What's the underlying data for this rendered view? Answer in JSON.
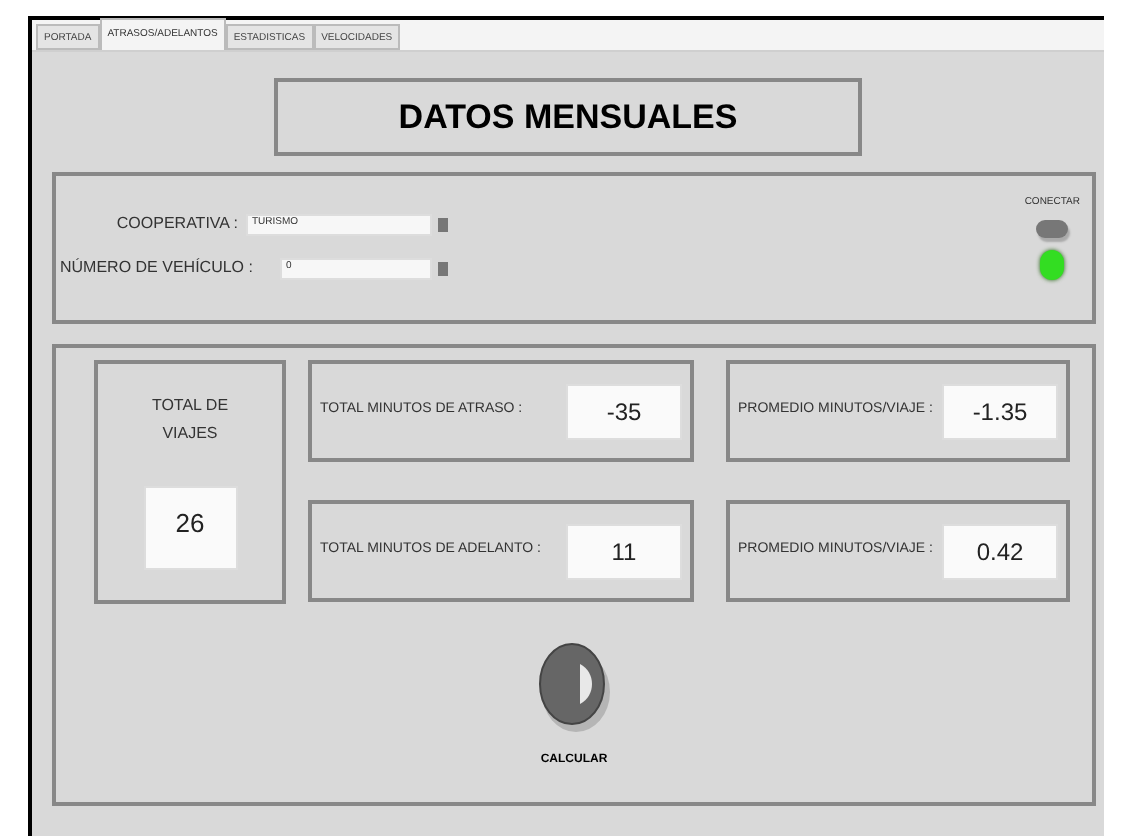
{
  "tabs": [
    {
      "label": "PORTADA",
      "selected": false
    },
    {
      "label": "ATRASOS/ADELANTOS",
      "selected": true
    },
    {
      "label": "ESTADISTICAS",
      "selected": false
    },
    {
      "label": "VELOCIDADES",
      "selected": false
    }
  ],
  "title": "DATOS MENSUALES",
  "connection": {
    "cooperativa_label": "COOPERATIVA :",
    "cooperativa_value": "TURISMO",
    "vehiculo_label": "NÚMERO DE VEHÍCULO :",
    "vehiculo_value": "0",
    "connect_label": "CONECTAR",
    "led_on": true
  },
  "total_viajes": {
    "label": "TOTAL DE VIAJES",
    "value": "26"
  },
  "indicators": [
    {
      "label": "TOTAL MINUTOS DE ATRASO :",
      "value": "-35"
    },
    {
      "label": "PROMEDIO MINUTOS/VIAJE :",
      "value": "-1.35"
    },
    {
      "label": "TOTAL MINUTOS DE ADELANTO :",
      "value": "11"
    },
    {
      "label": "PROMEDIO MINUTOS/VIAJE :",
      "value": "0.42"
    }
  ],
  "calcular_label": "CALCULAR"
}
